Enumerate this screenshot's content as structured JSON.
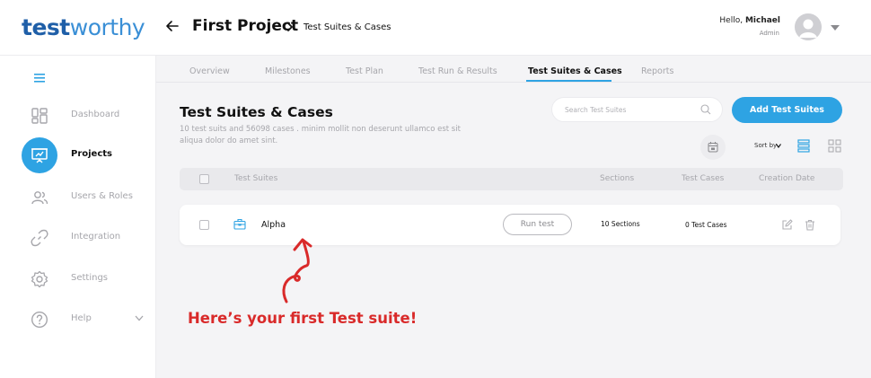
{
  "header": {
    "logo_bold": "test",
    "logo_light": "worthy",
    "project_title": "First Project",
    "breadcrumb_current": "Test Suites & Cases",
    "greeting_prefix": "Hello, ",
    "user_name": "Michael",
    "user_role": "Admin"
  },
  "sidebar": {
    "items": [
      {
        "label": "Dashboard",
        "icon": "dashboard-icon"
      },
      {
        "label": "Projects",
        "icon": "presentation-icon",
        "active": true
      },
      {
        "label": "Users & Roles",
        "icon": "users-icon"
      },
      {
        "label": "Integration",
        "icon": "link-icon"
      },
      {
        "label": "Settings",
        "icon": "gear-icon"
      },
      {
        "label": "Help",
        "icon": "help-icon"
      }
    ]
  },
  "tabs": [
    {
      "label": "Overview"
    },
    {
      "label": "Milestones"
    },
    {
      "label": "Test Plan"
    },
    {
      "label": "Test Run & Results"
    },
    {
      "label": "Test Suites & Cases",
      "active": true
    },
    {
      "label": "Reports"
    }
  ],
  "main": {
    "title": "Test Suites & Cases",
    "description": "10 test suits and 56098 cases . minim mollit non deserunt ullamco est sit aliqua dolor do amet sint.",
    "search_placeholder": "Search Test Suites",
    "add_button": "Add Test Suites",
    "sort_label": "Sort by"
  },
  "table": {
    "columns": [
      "Test Suites",
      "Sections",
      "Test Cases",
      "Creation Date"
    ],
    "rows": [
      {
        "name": "Alpha",
        "run_label": "Run test",
        "sections": "10 Sections",
        "test_cases": "0 Test Cases"
      }
    ]
  },
  "annotation": {
    "text": "Here’s your first Test suite!"
  },
  "colors": {
    "accent": "#2ea3e3",
    "annotation": "#d92a2a",
    "logo": "#2e6fb8"
  }
}
